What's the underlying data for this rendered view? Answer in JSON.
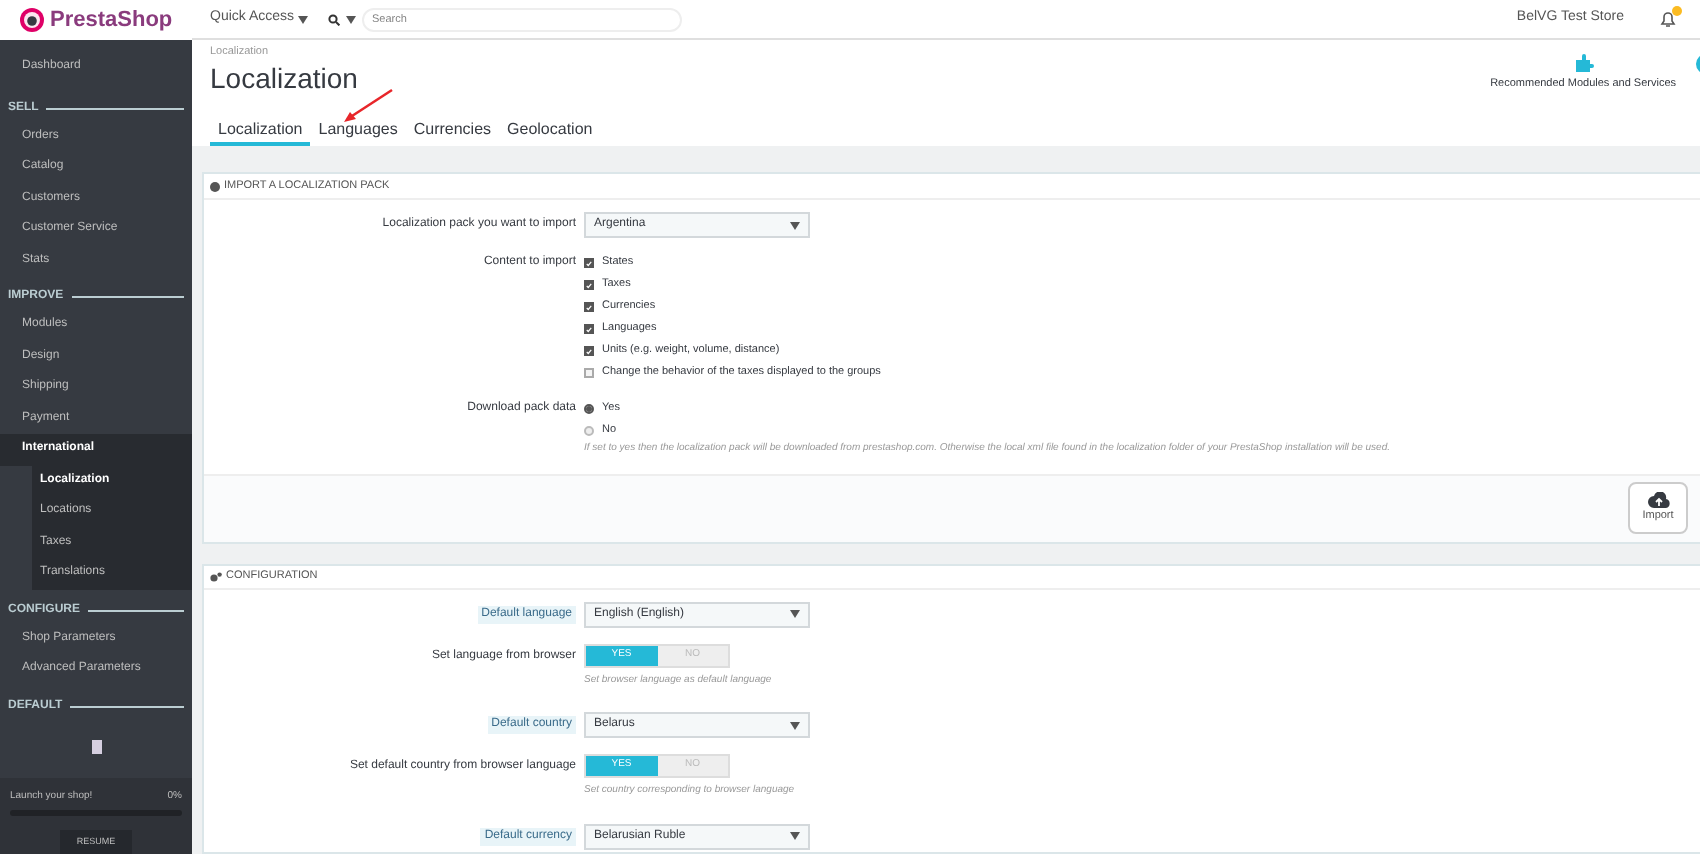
{
  "logo": {
    "text": "PrestaShop"
  },
  "topbar": {
    "quick_access": "Quick Access",
    "search_placeholder": "Search",
    "store_name": "BelVG Test Store"
  },
  "sidebar": {
    "items": [
      {
        "kind": "item",
        "label": "Dashboard",
        "selected": false
      },
      {
        "kind": "section",
        "label": "SELL"
      },
      {
        "kind": "item",
        "label": "Orders",
        "selected": false
      },
      {
        "kind": "item",
        "label": "Catalog",
        "selected": false
      },
      {
        "kind": "item",
        "label": "Customers",
        "selected": false
      },
      {
        "kind": "item",
        "label": "Customer Service",
        "selected": false
      },
      {
        "kind": "item",
        "label": "Stats",
        "selected": false
      },
      {
        "kind": "section",
        "label": "IMPROVE"
      },
      {
        "kind": "item",
        "label": "Modules",
        "selected": false
      },
      {
        "kind": "item",
        "label": "Design",
        "selected": false
      },
      {
        "kind": "item",
        "label": "Shipping",
        "selected": false
      },
      {
        "kind": "item",
        "label": "Payment",
        "selected": false
      },
      {
        "kind": "item",
        "label": "International",
        "selected": false,
        "expanded": true,
        "children": [
          {
            "label": "Localization",
            "selected": true
          },
          {
            "label": "Locations",
            "selected": false
          },
          {
            "label": "Taxes",
            "selected": false
          },
          {
            "label": "Translations",
            "selected": false
          }
        ]
      },
      {
        "kind": "section",
        "label": "CONFIGURE"
      },
      {
        "kind": "item",
        "label": "Shop Parameters",
        "selected": false
      },
      {
        "kind": "item",
        "label": "Advanced Parameters",
        "selected": false
      },
      {
        "kind": "section",
        "label": "DEFAULT"
      }
    ],
    "launch": {
      "label": "Launch your shop!",
      "percent": "0%",
      "level": 0,
      "button": "RESUME"
    }
  },
  "header": {
    "breadcrumb": "Localization",
    "title": "Localization",
    "toolbar": [
      {
        "label": "Recommended Modules and Services"
      }
    ],
    "tabs": [
      {
        "label": "Localization",
        "selected": true
      },
      {
        "label": "Languages",
        "selected": false
      },
      {
        "label": "Currencies",
        "selected": false
      },
      {
        "label": "Geolocation",
        "selected": false
      }
    ]
  },
  "import_panel": {
    "title": "IMPORT A LOCALIZATION PACK",
    "pack": {
      "label": "Localization pack you want to import",
      "value": "Argentina"
    },
    "content": {
      "label": "Content to import",
      "options": [
        {
          "label": "States",
          "checked": true
        },
        {
          "label": "Taxes",
          "checked": true
        },
        {
          "label": "Currencies",
          "checked": true
        },
        {
          "label": "Languages",
          "checked": true
        },
        {
          "label": "Units (e.g. weight, volume, distance)",
          "checked": true
        },
        {
          "label": "Change the behavior of the taxes displayed to the groups",
          "checked": false
        }
      ]
    },
    "download": {
      "label": "Download pack data",
      "options": [
        {
          "label": "Yes",
          "selected": true
        },
        {
          "label": "No",
          "selected": false
        }
      ],
      "help": "If set to yes then the localization pack will be downloaded from prestashop.com. Otherwise the local xml file found in the localization folder of your PrestaShop installation will be used."
    },
    "import_button": "Import"
  },
  "config_panel": {
    "title": "CONFIGURATION",
    "rows": [
      {
        "kind": "select",
        "label": "Default language",
        "value": "English (English)"
      },
      {
        "kind": "toggle",
        "label": "Set language from browser",
        "options": [
          {
            "label": "YES",
            "selected": true
          },
          {
            "label": "NO",
            "selected": false
          }
        ],
        "help": "Set browser language as default language"
      },
      {
        "kind": "select",
        "label": "Default country",
        "value": "Belarus"
      },
      {
        "kind": "toggle",
        "label": "Set default country from browser language",
        "options": [
          {
            "label": "YES",
            "selected": true
          },
          {
            "label": "NO",
            "selected": false
          }
        ],
        "help": "Set country corresponding to browser language"
      },
      {
        "kind": "select",
        "label": "Default currency",
        "value": "Belarusian Ruble"
      }
    ]
  }
}
